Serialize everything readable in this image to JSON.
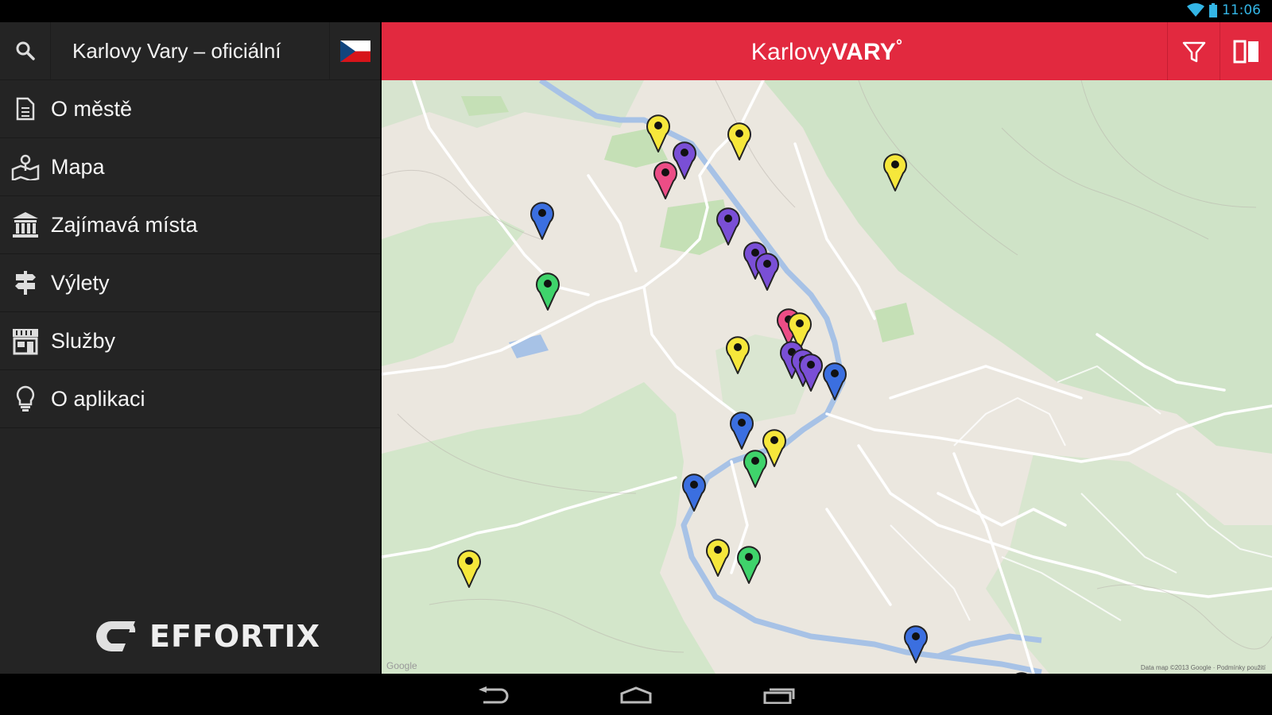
{
  "status_bar": {
    "time": "11:06"
  },
  "drawer": {
    "title": "Karlovy Vary – oficiální",
    "search_icon": "search-icon",
    "flag": "czech-flag",
    "items": [
      {
        "label": "O městě",
        "icon": "document-icon"
      },
      {
        "label": "Mapa",
        "icon": "map-pin-icon"
      },
      {
        "label": "Zajímavá místa",
        "icon": "museum-icon"
      },
      {
        "label": "Výlety",
        "icon": "signpost-icon"
      },
      {
        "label": "Služby",
        "icon": "shop-icon"
      },
      {
        "label": "O aplikaci",
        "icon": "lightbulb-icon"
      }
    ],
    "brand": "EFFORTIX"
  },
  "topbar": {
    "logo_main": "Karlovy",
    "logo_bold": "VARY",
    "logo_deg": "°",
    "filter_icon": "filter-icon",
    "book_icon": "book-icon"
  },
  "map": {
    "google": "Google",
    "credit": "Data map ©2013 Google · Podmínky použití"
  },
  "colors": {
    "accent": "#e2293f",
    "drawer_bg": "#242424",
    "pin_yellow": "#f6e73b",
    "pin_blue": "#3b6fe0",
    "pin_purple": "#7a4fd6",
    "pin_pink": "#ec4d86",
    "pin_green": "#3fd36b"
  },
  "pins": [
    {
      "color": "yellow"
    },
    {
      "color": "yellow"
    },
    {
      "color": "purple"
    },
    {
      "color": "pink"
    },
    {
      "color": "yellow"
    },
    {
      "color": "blue"
    },
    {
      "color": "purple"
    },
    {
      "color": "purple"
    },
    {
      "color": "purple"
    },
    {
      "color": "green"
    },
    {
      "color": "pink"
    },
    {
      "color": "yellow"
    },
    {
      "color": "yellow"
    },
    {
      "color": "purple"
    },
    {
      "color": "purple"
    },
    {
      "color": "purple"
    },
    {
      "color": "blue"
    },
    {
      "color": "blue"
    },
    {
      "color": "yellow"
    },
    {
      "color": "green"
    },
    {
      "color": "blue"
    },
    {
      "color": "yellow"
    },
    {
      "color": "yellow"
    },
    {
      "color": "green"
    },
    {
      "color": "blue"
    },
    {
      "color": "yellow"
    }
  ]
}
